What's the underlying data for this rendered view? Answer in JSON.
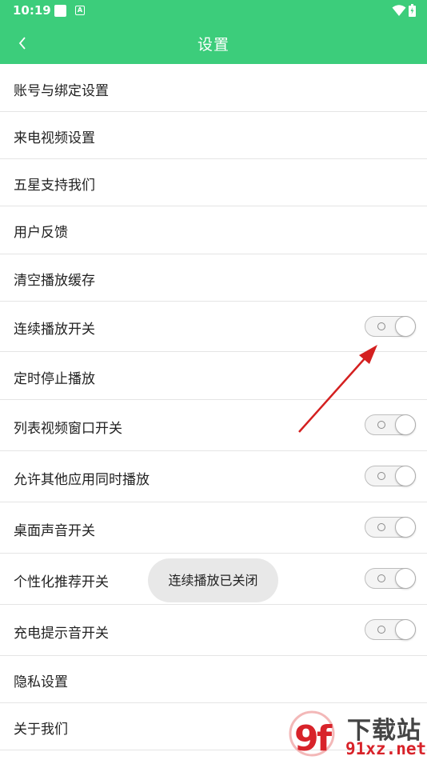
{
  "status_bar": {
    "time": "10:19",
    "a_icon_text": "A"
  },
  "app_bar": {
    "title": "设置",
    "back_icon": "chevron-left-icon"
  },
  "settings": {
    "account_binding": "账号与绑定设置",
    "ringtone_video": "来电视频设置",
    "five_star": "五星支持我们",
    "feedback": "用户反馈",
    "clear_cache": "清空播放缓存",
    "continuous_play": "连续播放开关",
    "timer_stop": "定时停止播放",
    "list_video_window": "列表视频窗口开关",
    "allow_other_apps": "允许其他应用同时播放",
    "desktop_sound": "桌面声音开关",
    "personalized_recommend": "个性化推荐开关",
    "charging_sound": "充电提示音开关",
    "privacy": "隐私设置",
    "about_us": "关于我们"
  },
  "switch_states": {
    "continuous_play": false,
    "list_video_window": false,
    "allow_other_apps": false,
    "desktop_sound": false,
    "personalized_recommend": false,
    "charging_sound": false
  },
  "toast": {
    "text": "连续播放已关闭"
  },
  "watermark": {
    "name": "下载站",
    "url": "91xz.net",
    "logo_text": "9f"
  },
  "colors": {
    "accent": "#3ccd7b",
    "divider": "#e4e4e4",
    "annotation_arrow": "#d42020",
    "watermark_red": "#d8232a"
  }
}
